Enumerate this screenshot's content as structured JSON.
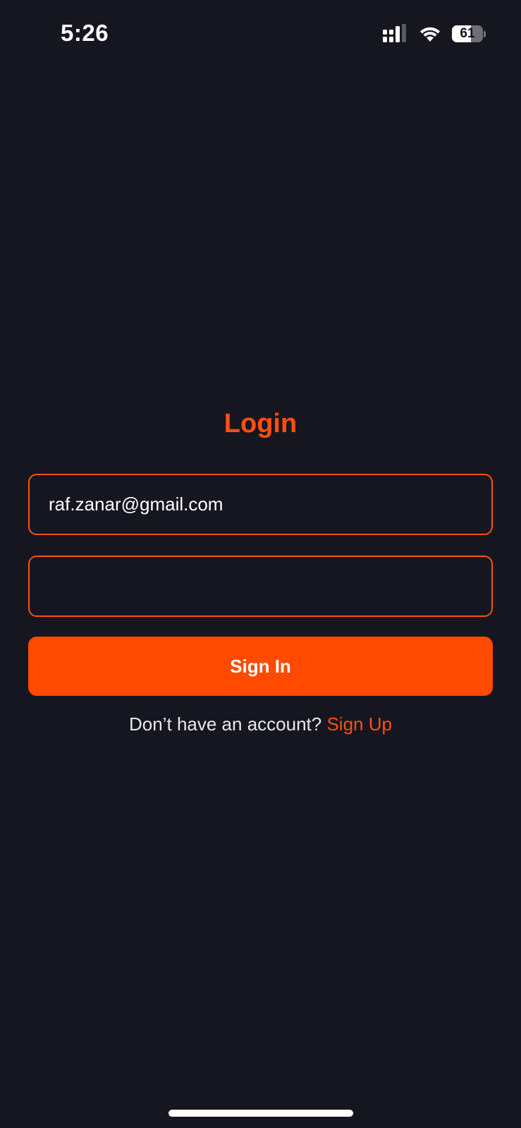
{
  "status_bar": {
    "time": "5:26",
    "battery_level": "61",
    "battery_fraction": 0.61,
    "icons": [
      "cellular-signal-icon",
      "wifi-icon",
      "battery-icon"
    ]
  },
  "login": {
    "title": "Login",
    "email_value": "raf.zanar@gmail.com",
    "password_value": "",
    "sign_in_label": "Sign In",
    "no_account_text": "Don’t have an account?",
    "sign_up_label": "Sign Up"
  },
  "colors": {
    "background": "#161620",
    "accent": "#ff4f0f",
    "button": "#ff4a00",
    "text": "#ffffff"
  }
}
